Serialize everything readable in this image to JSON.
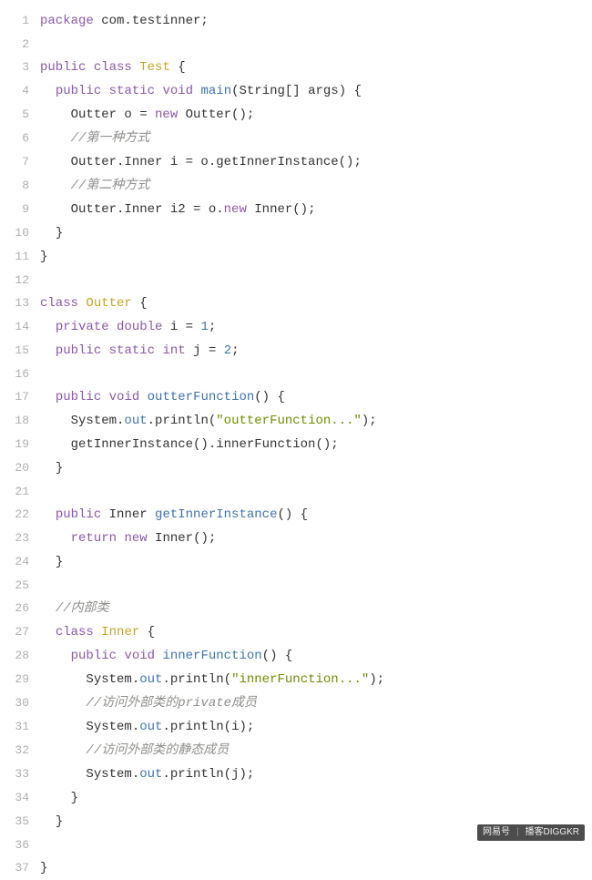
{
  "watermark": {
    "brand": "网易号",
    "author": "播客DIGGKR"
  },
  "chart_data": {
    "type": "table",
    "language": "java",
    "lines": [
      {
        "n": 1,
        "indent": 0,
        "tokens": [
          [
            "keyword",
            "package"
          ],
          [
            "default",
            " com.testinner;"
          ]
        ]
      },
      {
        "n": 2,
        "indent": 0,
        "tokens": []
      },
      {
        "n": 3,
        "indent": 0,
        "tokens": [
          [
            "keyword",
            "public"
          ],
          [
            "default",
            " "
          ],
          [
            "keyword",
            "class"
          ],
          [
            "default",
            " "
          ],
          [
            "class",
            "Test"
          ],
          [
            "default",
            " {"
          ]
        ]
      },
      {
        "n": 4,
        "indent": 1,
        "tokens": [
          [
            "keyword",
            "public"
          ],
          [
            "default",
            " "
          ],
          [
            "keyword",
            "static"
          ],
          [
            "default",
            " "
          ],
          [
            "keyword",
            "void"
          ],
          [
            "default",
            " "
          ],
          [
            "method",
            "main"
          ],
          [
            "default",
            "(String[] args) {"
          ]
        ]
      },
      {
        "n": 5,
        "indent": 2,
        "tokens": [
          [
            "default",
            "Outter o = "
          ],
          [
            "keyword",
            "new"
          ],
          [
            "default",
            " Outter();"
          ]
        ]
      },
      {
        "n": 6,
        "indent": 2,
        "tokens": [
          [
            "comment",
            "//第一种方式"
          ]
        ]
      },
      {
        "n": 7,
        "indent": 2,
        "tokens": [
          [
            "default",
            "Outter.Inner i = o.getInnerInstance();"
          ]
        ]
      },
      {
        "n": 8,
        "indent": 2,
        "tokens": [
          [
            "comment",
            "//第二种方式"
          ]
        ]
      },
      {
        "n": 9,
        "indent": 2,
        "tokens": [
          [
            "default",
            "Outter.Inner i2 = o."
          ],
          [
            "keyword",
            "new"
          ],
          [
            "default",
            " Inner();"
          ]
        ]
      },
      {
        "n": 10,
        "indent": 1,
        "tokens": [
          [
            "default",
            "}"
          ]
        ]
      },
      {
        "n": 11,
        "indent": 0,
        "tokens": [
          [
            "default",
            "}"
          ]
        ]
      },
      {
        "n": 12,
        "indent": 0,
        "tokens": []
      },
      {
        "n": 13,
        "indent": 0,
        "tokens": [
          [
            "keyword",
            "class"
          ],
          [
            "default",
            " "
          ],
          [
            "class",
            "Outter"
          ],
          [
            "default",
            " {"
          ]
        ]
      },
      {
        "n": 14,
        "indent": 1,
        "tokens": [
          [
            "keyword",
            "private"
          ],
          [
            "default",
            " "
          ],
          [
            "keyword",
            "double"
          ],
          [
            "default",
            " i = "
          ],
          [
            "number",
            "1"
          ],
          [
            "default",
            ";"
          ]
        ]
      },
      {
        "n": 15,
        "indent": 1,
        "tokens": [
          [
            "keyword",
            "public"
          ],
          [
            "default",
            " "
          ],
          [
            "keyword",
            "static"
          ],
          [
            "default",
            " "
          ],
          [
            "keyword",
            "int"
          ],
          [
            "default",
            " j = "
          ],
          [
            "number",
            "2"
          ],
          [
            "default",
            ";"
          ]
        ]
      },
      {
        "n": 16,
        "indent": 0,
        "tokens": []
      },
      {
        "n": 17,
        "indent": 1,
        "tokens": [
          [
            "keyword",
            "public"
          ],
          [
            "default",
            " "
          ],
          [
            "keyword",
            "void"
          ],
          [
            "default",
            " "
          ],
          [
            "method",
            "outterFunction"
          ],
          [
            "default",
            "() {"
          ]
        ]
      },
      {
        "n": 18,
        "indent": 2,
        "tokens": [
          [
            "default",
            "System."
          ],
          [
            "qual",
            "out"
          ],
          [
            "default",
            ".println("
          ],
          [
            "string",
            "\"outterFunction...\""
          ],
          [
            "default",
            ");"
          ]
        ]
      },
      {
        "n": 19,
        "indent": 2,
        "tokens": [
          [
            "default",
            "getInnerInstance().innerFunction();"
          ]
        ]
      },
      {
        "n": 20,
        "indent": 1,
        "tokens": [
          [
            "default",
            "}"
          ]
        ]
      },
      {
        "n": 21,
        "indent": 0,
        "tokens": []
      },
      {
        "n": 22,
        "indent": 1,
        "tokens": [
          [
            "keyword",
            "public"
          ],
          [
            "default",
            " Inner "
          ],
          [
            "method",
            "getInnerInstance"
          ],
          [
            "default",
            "() {"
          ]
        ]
      },
      {
        "n": 23,
        "indent": 2,
        "tokens": [
          [
            "keyword",
            "return"
          ],
          [
            "default",
            " "
          ],
          [
            "keyword",
            "new"
          ],
          [
            "default",
            " Inner();"
          ]
        ]
      },
      {
        "n": 24,
        "indent": 1,
        "tokens": [
          [
            "default",
            "}"
          ]
        ]
      },
      {
        "n": 25,
        "indent": 0,
        "tokens": []
      },
      {
        "n": 26,
        "indent": 1,
        "tokens": [
          [
            "comment",
            "//内部类"
          ]
        ]
      },
      {
        "n": 27,
        "indent": 1,
        "tokens": [
          [
            "keyword",
            "class"
          ],
          [
            "default",
            " "
          ],
          [
            "class",
            "Inner"
          ],
          [
            "default",
            " {"
          ]
        ]
      },
      {
        "n": 28,
        "indent": 2,
        "tokens": [
          [
            "keyword",
            "public"
          ],
          [
            "default",
            " "
          ],
          [
            "keyword",
            "void"
          ],
          [
            "default",
            " "
          ],
          [
            "method",
            "innerFunction"
          ],
          [
            "default",
            "() {"
          ]
        ]
      },
      {
        "n": 29,
        "indent": 3,
        "tokens": [
          [
            "default",
            "System."
          ],
          [
            "qual",
            "out"
          ],
          [
            "default",
            ".println("
          ],
          [
            "string",
            "\"innerFunction...\""
          ],
          [
            "default",
            ");"
          ]
        ]
      },
      {
        "n": 30,
        "indent": 3,
        "tokens": [
          [
            "comment",
            "//访问外部类的private成员"
          ]
        ]
      },
      {
        "n": 31,
        "indent": 3,
        "tokens": [
          [
            "default",
            "System."
          ],
          [
            "qual",
            "out"
          ],
          [
            "default",
            ".println(i);"
          ]
        ]
      },
      {
        "n": 32,
        "indent": 3,
        "tokens": [
          [
            "comment",
            "//访问外部类的静态成员"
          ]
        ]
      },
      {
        "n": 33,
        "indent": 3,
        "tokens": [
          [
            "default",
            "System."
          ],
          [
            "qual",
            "out"
          ],
          [
            "default",
            ".println(j);"
          ]
        ]
      },
      {
        "n": 34,
        "indent": 2,
        "tokens": [
          [
            "default",
            "}"
          ]
        ]
      },
      {
        "n": 35,
        "indent": 1,
        "tokens": [
          [
            "default",
            "}"
          ]
        ]
      },
      {
        "n": 36,
        "indent": 0,
        "tokens": []
      },
      {
        "n": 37,
        "indent": 0,
        "tokens": [
          [
            "default",
            "}"
          ]
        ]
      }
    ]
  }
}
